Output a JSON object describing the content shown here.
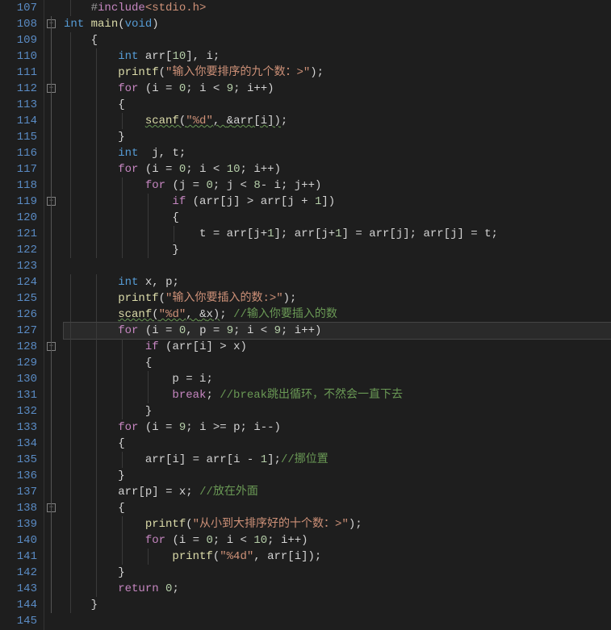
{
  "startLine": 107,
  "currentLine": 127,
  "foldBoxes": [
    108,
    112,
    119,
    128,
    138
  ],
  "code": [
    {
      "n": 107,
      "indent": 1,
      "tokens": [
        [
          "pp",
          "#"
        ],
        [
          "kw2",
          "include"
        ],
        [
          "incfile",
          "<stdio.h>"
        ]
      ]
    },
    {
      "n": 108,
      "indent": 0,
      "tokens": [
        [
          "kw",
          "int"
        ],
        [
          "id",
          " "
        ],
        [
          "fn",
          "main"
        ],
        [
          "punc",
          "("
        ],
        [
          "kw",
          "void"
        ],
        [
          "punc",
          ")"
        ]
      ]
    },
    {
      "n": 109,
      "indent": 1,
      "tokens": [
        [
          "punc",
          "{"
        ]
      ]
    },
    {
      "n": 110,
      "indent": 2,
      "tokens": [
        [
          "kw",
          "int"
        ],
        [
          "id",
          " arr"
        ],
        [
          "punc",
          "["
        ],
        [
          "num",
          "10"
        ],
        [
          "punc",
          "], "
        ],
        [
          "id",
          "i"
        ],
        [
          "punc",
          ";"
        ]
      ]
    },
    {
      "n": 111,
      "indent": 2,
      "tokens": [
        [
          "fn",
          "printf"
        ],
        [
          "punc",
          "("
        ],
        [
          "str",
          "\"输入你要排序的九个数：>\""
        ],
        [
          "punc",
          ");"
        ]
      ]
    },
    {
      "n": 112,
      "indent": 2,
      "tokens": [
        [
          "kw2",
          "for"
        ],
        [
          "punc",
          " ("
        ],
        [
          "id",
          "i"
        ],
        [
          "op",
          " = "
        ],
        [
          "num",
          "0"
        ],
        [
          "punc",
          "; "
        ],
        [
          "id",
          "i"
        ],
        [
          "op",
          " < "
        ],
        [
          "num",
          "9"
        ],
        [
          "punc",
          "; "
        ],
        [
          "id",
          "i"
        ],
        [
          "op",
          "++"
        ],
        [
          "punc",
          ")"
        ]
      ]
    },
    {
      "n": 113,
      "indent": 2,
      "tokens": [
        [
          "punc",
          "{"
        ]
      ]
    },
    {
      "n": 114,
      "indent": 3,
      "tokens": [
        [
          "fn wavy",
          "scanf"
        ],
        [
          "punc wavy",
          "("
        ],
        [
          "str wavy",
          "\"%d\""
        ],
        [
          "punc wavy",
          ", "
        ],
        [
          "op wavy",
          "&"
        ],
        [
          "id wavy",
          "arr"
        ],
        [
          "punc wavy",
          "["
        ],
        [
          "id wavy",
          "i"
        ],
        [
          "punc wavy",
          "])"
        ],
        [
          "punc",
          ";"
        ]
      ]
    },
    {
      "n": 115,
      "indent": 2,
      "tokens": [
        [
          "punc",
          "}"
        ]
      ]
    },
    {
      "n": 116,
      "indent": 2,
      "tokens": [
        [
          "kw",
          "int"
        ],
        [
          "id",
          "  j"
        ],
        [
          "punc",
          ", "
        ],
        [
          "id",
          "t"
        ],
        [
          "punc",
          ";"
        ]
      ]
    },
    {
      "n": 117,
      "indent": 2,
      "tokens": [
        [
          "kw2",
          "for"
        ],
        [
          "punc",
          " ("
        ],
        [
          "id",
          "i"
        ],
        [
          "op",
          " = "
        ],
        [
          "num",
          "0"
        ],
        [
          "punc",
          "; "
        ],
        [
          "id",
          "i"
        ],
        [
          "op",
          " < "
        ],
        [
          "num",
          "10"
        ],
        [
          "punc",
          "; "
        ],
        [
          "id",
          "i"
        ],
        [
          "op",
          "++"
        ],
        [
          "punc",
          ")"
        ]
      ]
    },
    {
      "n": 118,
      "indent": 3,
      "tokens": [
        [
          "kw2",
          "for"
        ],
        [
          "punc",
          " ("
        ],
        [
          "id",
          "j"
        ],
        [
          "op",
          " = "
        ],
        [
          "num",
          "0"
        ],
        [
          "punc",
          "; "
        ],
        [
          "id",
          "j"
        ],
        [
          "op",
          " < "
        ],
        [
          "num",
          "8"
        ],
        [
          "op",
          "- "
        ],
        [
          "id",
          "i"
        ],
        [
          "punc",
          "; "
        ],
        [
          "id",
          "j"
        ],
        [
          "op",
          "++"
        ],
        [
          "punc",
          ")"
        ]
      ]
    },
    {
      "n": 119,
      "indent": 4,
      "tokens": [
        [
          "kw2",
          "if"
        ],
        [
          "punc",
          " ("
        ],
        [
          "id",
          "arr"
        ],
        [
          "punc",
          "["
        ],
        [
          "id",
          "j"
        ],
        [
          "punc",
          "] "
        ],
        [
          "op",
          ">"
        ],
        [
          "punc",
          " "
        ],
        [
          "id",
          "arr"
        ],
        [
          "punc",
          "["
        ],
        [
          "id",
          "j"
        ],
        [
          "op",
          " + "
        ],
        [
          "num",
          "1"
        ],
        [
          "punc",
          "])"
        ]
      ]
    },
    {
      "n": 120,
      "indent": 4,
      "tokens": [
        [
          "punc",
          "{"
        ]
      ]
    },
    {
      "n": 121,
      "indent": 5,
      "tokens": [
        [
          "id",
          "t"
        ],
        [
          "op",
          " = "
        ],
        [
          "id",
          "arr"
        ],
        [
          "punc",
          "["
        ],
        [
          "id",
          "j"
        ],
        [
          "op",
          "+"
        ],
        [
          "num",
          "1"
        ],
        [
          "punc",
          "]; "
        ],
        [
          "id",
          "arr"
        ],
        [
          "punc",
          "["
        ],
        [
          "id",
          "j"
        ],
        [
          "op",
          "+"
        ],
        [
          "num",
          "1"
        ],
        [
          "punc",
          "] "
        ],
        [
          "op",
          "="
        ],
        [
          "punc",
          " "
        ],
        [
          "id",
          "arr"
        ],
        [
          "punc",
          "["
        ],
        [
          "id",
          "j"
        ],
        [
          "punc",
          "]; "
        ],
        [
          "id",
          "arr"
        ],
        [
          "punc",
          "["
        ],
        [
          "id",
          "j"
        ],
        [
          "punc",
          "] "
        ],
        [
          "op",
          "="
        ],
        [
          "punc",
          " "
        ],
        [
          "id",
          "t"
        ],
        [
          "punc",
          ";"
        ]
      ]
    },
    {
      "n": 122,
      "indent": 4,
      "tokens": [
        [
          "punc",
          "}"
        ]
      ]
    },
    {
      "n": 123,
      "indent": 0,
      "tokens": []
    },
    {
      "n": 124,
      "indent": 2,
      "tokens": [
        [
          "kw",
          "int"
        ],
        [
          "id",
          " x"
        ],
        [
          "punc",
          ", "
        ],
        [
          "id",
          "p"
        ],
        [
          "punc",
          ";"
        ]
      ]
    },
    {
      "n": 125,
      "indent": 2,
      "tokens": [
        [
          "fn",
          "printf"
        ],
        [
          "punc",
          "("
        ],
        [
          "str",
          "\"输入你要插入的数:>\""
        ],
        [
          "punc",
          ");"
        ]
      ]
    },
    {
      "n": 126,
      "indent": 2,
      "tokens": [
        [
          "fn wavy",
          "scanf"
        ],
        [
          "punc wavy",
          "("
        ],
        [
          "str wavy",
          "\"%d\""
        ],
        [
          "punc wavy",
          ", "
        ],
        [
          "op wavy",
          "&"
        ],
        [
          "id wavy",
          "x"
        ],
        [
          "punc wavy",
          ")"
        ],
        [
          "punc",
          "; "
        ],
        [
          "cm",
          "//输入你要插入的数"
        ]
      ]
    },
    {
      "n": 127,
      "indent": 2,
      "tokens": [
        [
          "kw2",
          "for"
        ],
        [
          "punc",
          " ("
        ],
        [
          "id",
          "i"
        ],
        [
          "op",
          " = "
        ],
        [
          "num",
          "0"
        ],
        [
          "punc",
          ", "
        ],
        [
          "id",
          "p"
        ],
        [
          "op",
          " = "
        ],
        [
          "num",
          "9"
        ],
        [
          "punc",
          "; "
        ],
        [
          "id",
          "i"
        ],
        [
          "op",
          " < "
        ],
        [
          "num",
          "9"
        ],
        [
          "punc",
          "; "
        ],
        [
          "id",
          "i"
        ],
        [
          "op",
          "++"
        ],
        [
          "punc",
          ")"
        ]
      ]
    },
    {
      "n": 128,
      "indent": 3,
      "tokens": [
        [
          "kw2",
          "if"
        ],
        [
          "punc",
          " ("
        ],
        [
          "id",
          "arr"
        ],
        [
          "punc",
          "["
        ],
        [
          "id",
          "i"
        ],
        [
          "punc",
          "] "
        ],
        [
          "op",
          ">"
        ],
        [
          "punc",
          " "
        ],
        [
          "id",
          "x"
        ],
        [
          "punc",
          ")"
        ]
      ]
    },
    {
      "n": 129,
      "indent": 3,
      "tokens": [
        [
          "punc",
          "{"
        ]
      ]
    },
    {
      "n": 130,
      "indent": 4,
      "tokens": [
        [
          "id",
          "p"
        ],
        [
          "op",
          " = "
        ],
        [
          "id",
          "i"
        ],
        [
          "punc",
          ";"
        ]
      ]
    },
    {
      "n": 131,
      "indent": 4,
      "tokens": [
        [
          "kw2",
          "break"
        ],
        [
          "punc",
          "; "
        ],
        [
          "cm",
          "//break跳出循环，不然会一直下去"
        ]
      ]
    },
    {
      "n": 132,
      "indent": 3,
      "tokens": [
        [
          "punc",
          "}"
        ]
      ]
    },
    {
      "n": 133,
      "indent": 2,
      "tokens": [
        [
          "kw2",
          "for"
        ],
        [
          "punc",
          " ("
        ],
        [
          "id",
          "i"
        ],
        [
          "op",
          " = "
        ],
        [
          "num",
          "9"
        ],
        [
          "punc",
          "; "
        ],
        [
          "id",
          "i"
        ],
        [
          "op",
          " >= "
        ],
        [
          "id",
          "p"
        ],
        [
          "punc",
          "; "
        ],
        [
          "id",
          "i"
        ],
        [
          "op",
          "--"
        ],
        [
          "punc",
          ")"
        ]
      ]
    },
    {
      "n": 134,
      "indent": 2,
      "tokens": [
        [
          "punc",
          "{"
        ]
      ]
    },
    {
      "n": 135,
      "indent": 3,
      "tokens": [
        [
          "id",
          "arr"
        ],
        [
          "punc",
          "["
        ],
        [
          "id",
          "i"
        ],
        [
          "punc",
          "] "
        ],
        [
          "op",
          "="
        ],
        [
          "punc",
          " "
        ],
        [
          "id",
          "arr"
        ],
        [
          "punc",
          "["
        ],
        [
          "id",
          "i"
        ],
        [
          "op",
          " - "
        ],
        [
          "num",
          "1"
        ],
        [
          "punc",
          "];"
        ],
        [
          "cm",
          "//挪位置"
        ]
      ]
    },
    {
      "n": 136,
      "indent": 2,
      "tokens": [
        [
          "punc",
          "}"
        ]
      ]
    },
    {
      "n": 137,
      "indent": 2,
      "tokens": [
        [
          "id",
          "arr"
        ],
        [
          "punc",
          "["
        ],
        [
          "id",
          "p"
        ],
        [
          "punc",
          "] "
        ],
        [
          "op",
          "="
        ],
        [
          "punc",
          " "
        ],
        [
          "id",
          "x"
        ],
        [
          "punc",
          "; "
        ],
        [
          "cm",
          "//放在外面"
        ]
      ]
    },
    {
      "n": 138,
      "indent": 2,
      "tokens": [
        [
          "punc",
          "{"
        ]
      ]
    },
    {
      "n": 139,
      "indent": 3,
      "tokens": [
        [
          "fn",
          "printf"
        ],
        [
          "punc",
          "("
        ],
        [
          "str",
          "\"从小到大排序好的十个数：>\""
        ],
        [
          "punc",
          ");"
        ]
      ]
    },
    {
      "n": 140,
      "indent": 3,
      "tokens": [
        [
          "kw2",
          "for"
        ],
        [
          "punc",
          " ("
        ],
        [
          "id",
          "i"
        ],
        [
          "op",
          " = "
        ],
        [
          "num",
          "0"
        ],
        [
          "punc",
          "; "
        ],
        [
          "id",
          "i"
        ],
        [
          "op",
          " < "
        ],
        [
          "num",
          "10"
        ],
        [
          "punc",
          "; "
        ],
        [
          "id",
          "i"
        ],
        [
          "op",
          "++"
        ],
        [
          "punc",
          ")"
        ]
      ]
    },
    {
      "n": 141,
      "indent": 4,
      "tokens": [
        [
          "fn",
          "printf"
        ],
        [
          "punc",
          "("
        ],
        [
          "str",
          "\"%4d\""
        ],
        [
          "punc",
          ", "
        ],
        [
          "id",
          "arr"
        ],
        [
          "punc",
          "["
        ],
        [
          "id",
          "i"
        ],
        [
          "punc",
          "]);"
        ]
      ]
    },
    {
      "n": 142,
      "indent": 2,
      "tokens": [
        [
          "punc",
          "}"
        ]
      ]
    },
    {
      "n": 143,
      "indent": 2,
      "tokens": [
        [
          "kw2",
          "return"
        ],
        [
          "punc",
          " "
        ],
        [
          "num",
          "0"
        ],
        [
          "punc",
          ";"
        ]
      ]
    },
    {
      "n": 144,
      "indent": 1,
      "tokens": [
        [
          "punc",
          "}"
        ]
      ]
    },
    {
      "n": 145,
      "indent": 0,
      "tokens": []
    }
  ]
}
